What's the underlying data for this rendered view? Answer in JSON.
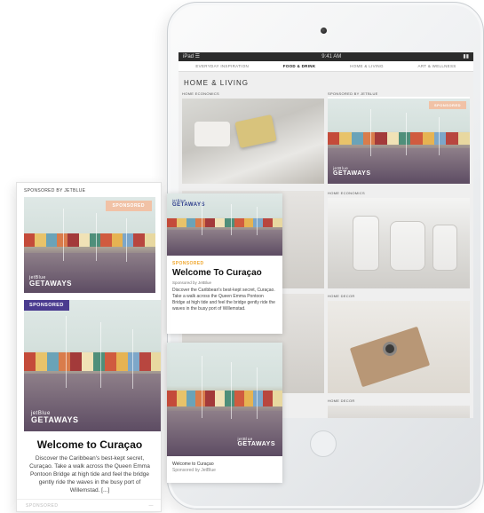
{
  "ipad": {
    "status": {
      "left": "iPad ☰",
      "time": "9:41 AM",
      "right": "▮▮"
    },
    "nav": [
      "Everyday Inspiration",
      "Food & Drink",
      "Home & Living",
      "Art & Wellness"
    ],
    "section_title": "Home & Living",
    "tiles": [
      {
        "label": "Home Economics",
        "kind": "bed"
      },
      {
        "label": "Sponsored by JetBlue",
        "kind": "curacao"
      },
      {
        "label": "",
        "kind": "misc"
      },
      {
        "label": "Home Economics",
        "kind": "jars"
      },
      {
        "label": "",
        "kind": "misc"
      },
      {
        "label": "Home Decor",
        "kind": "desk"
      },
      {
        "label": "Home Decor",
        "kind": "misc"
      }
    ]
  },
  "phone": {
    "header": "Sponsored by JetBlue",
    "top_banner_flag": "Sponsored",
    "pill": "SPONSORED",
    "title": "Welcome to Curaçao",
    "body": "Discover the Caribbean's best-kept secret, Curaçao. Take a walk across the Queen Emma Pontoon Bridge at high tide and feel the bridge gently ride the waves in the busy port of Willemstad. [...]",
    "footer_left": "SPONSORED",
    "footer_right": "—"
  },
  "logo": {
    "brand": "jetBlue",
    "word": "GETAWAYS"
  },
  "card_top": {
    "tag": "SPONSORED",
    "title": "Welcome To Curaçao",
    "sub": "Sponsored by JetBlue",
    "body": "Discover the Caribbean's best-kept secret, Curaçao. Take a walk across the Queen Emma Pontoon Bridge at high tide and feel the bridge gently ride the waves in the busy port of Willemstad."
  },
  "card_bottom": {
    "title": "Welcome to Curaçao",
    "sub": "Sponsored by JetBlue"
  },
  "colors": {
    "house_row": [
      "#c44b3a",
      "#e8c36a",
      "#6aa3b8",
      "#d97c4b",
      "#a33a3a",
      "#f0e2b6",
      "#4f8f7a",
      "#d05b3f",
      "#e6b352",
      "#7da7c9",
      "#b8463f",
      "#e8d8a0"
    ],
    "sponsored_pill": "#4a3b8f",
    "sponsored_tag": "#f0a830"
  }
}
